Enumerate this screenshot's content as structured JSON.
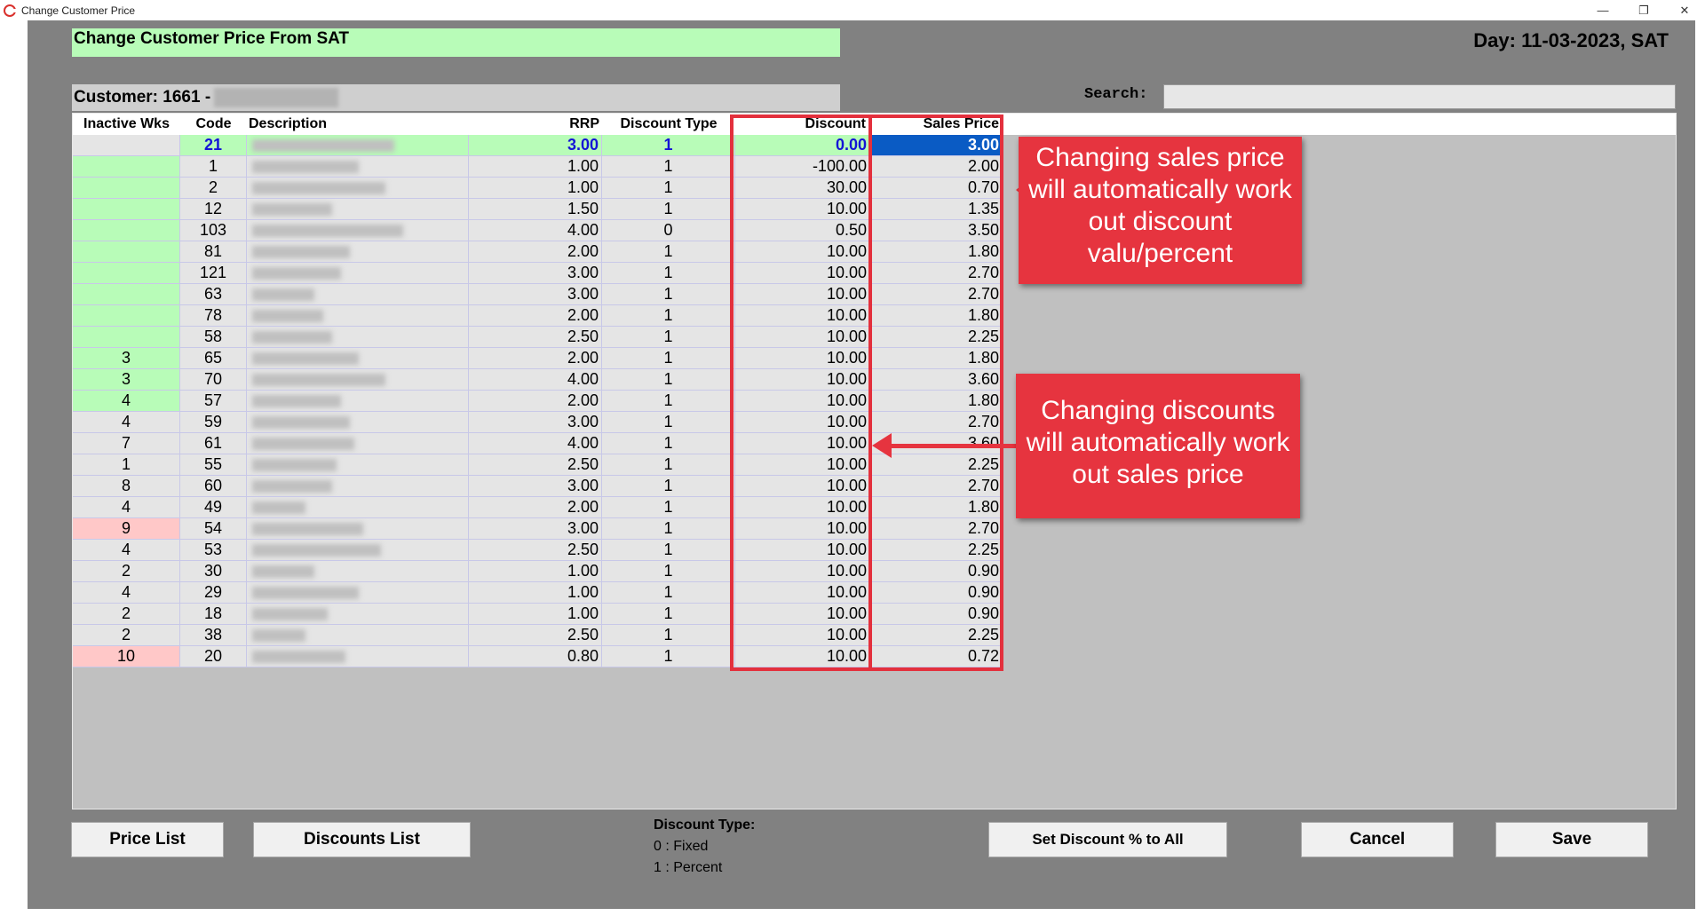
{
  "window": {
    "title": "Change Customer Price",
    "controls": [
      "minimize-icon",
      "restore-icon",
      "close-icon"
    ]
  },
  "header": {
    "title": "Change Customer Price From SAT",
    "day": "Day: 11-03-2023, SAT"
  },
  "customer": {
    "label": "Customer: 1661 -"
  },
  "search": {
    "label": "Search:",
    "value": ""
  },
  "table": {
    "columns": {
      "inactive": "Inactive Wks",
      "code": "Code",
      "description": "Description",
      "rrp": "RRP",
      "discount_type": "Discount Type",
      "discount": "Discount",
      "sales_price": "Sales Price"
    },
    "rows": [
      {
        "inactive": "",
        "code": "21",
        "rrp": "3.00",
        "dtype": "1",
        "discount": "0.00",
        "sales": "3.00",
        "inactive_bg": "none"
      },
      {
        "inactive": "",
        "code": "1",
        "rrp": "1.00",
        "dtype": "1",
        "discount": "-100.00",
        "sales": "2.00",
        "inactive_bg": "green"
      },
      {
        "inactive": "",
        "code": "2",
        "rrp": "1.00",
        "dtype": "1",
        "discount": "30.00",
        "sales": "0.70",
        "inactive_bg": "green"
      },
      {
        "inactive": "",
        "code": "12",
        "rrp": "1.50",
        "dtype": "1",
        "discount": "10.00",
        "sales": "1.35",
        "inactive_bg": "green"
      },
      {
        "inactive": "",
        "code": "103",
        "rrp": "4.00",
        "dtype": "0",
        "discount": "0.50",
        "sales": "3.50",
        "inactive_bg": "green"
      },
      {
        "inactive": "",
        "code": "81",
        "rrp": "2.00",
        "dtype": "1",
        "discount": "10.00",
        "sales": "1.80",
        "inactive_bg": "green"
      },
      {
        "inactive": "",
        "code": "121",
        "rrp": "3.00",
        "dtype": "1",
        "discount": "10.00",
        "sales": "2.70",
        "inactive_bg": "green"
      },
      {
        "inactive": "",
        "code": "63",
        "rrp": "3.00",
        "dtype": "1",
        "discount": "10.00",
        "sales": "2.70",
        "inactive_bg": "green"
      },
      {
        "inactive": "",
        "code": "78",
        "rrp": "2.00",
        "dtype": "1",
        "discount": "10.00",
        "sales": "1.80",
        "inactive_bg": "green"
      },
      {
        "inactive": "",
        "code": "58",
        "rrp": "2.50",
        "dtype": "1",
        "discount": "10.00",
        "sales": "2.25",
        "inactive_bg": "green"
      },
      {
        "inactive": "3",
        "code": "65",
        "rrp": "2.00",
        "dtype": "1",
        "discount": "10.00",
        "sales": "1.80",
        "inactive_bg": "green"
      },
      {
        "inactive": "3",
        "code": "70",
        "rrp": "4.00",
        "dtype": "1",
        "discount": "10.00",
        "sales": "3.60",
        "inactive_bg": "green"
      },
      {
        "inactive": "4",
        "code": "57",
        "rrp": "2.00",
        "dtype": "1",
        "discount": "10.00",
        "sales": "1.80",
        "inactive_bg": "green"
      },
      {
        "inactive": "4",
        "code": "59",
        "rrp": "3.00",
        "dtype": "1",
        "discount": "10.00",
        "sales": "2.70",
        "inactive_bg": "none"
      },
      {
        "inactive": "7",
        "code": "61",
        "rrp": "4.00",
        "dtype": "1",
        "discount": "10.00",
        "sales": "3.60",
        "inactive_bg": "none"
      },
      {
        "inactive": "1",
        "code": "55",
        "rrp": "2.50",
        "dtype": "1",
        "discount": "10.00",
        "sales": "2.25",
        "inactive_bg": "none"
      },
      {
        "inactive": "8",
        "code": "60",
        "rrp": "3.00",
        "dtype": "1",
        "discount": "10.00",
        "sales": "2.70",
        "inactive_bg": "none"
      },
      {
        "inactive": "4",
        "code": "49",
        "rrp": "2.00",
        "dtype": "1",
        "discount": "10.00",
        "sales": "1.80",
        "inactive_bg": "none"
      },
      {
        "inactive": "9",
        "code": "54",
        "rrp": "3.00",
        "dtype": "1",
        "discount": "10.00",
        "sales": "2.70",
        "inactive_bg": "pink"
      },
      {
        "inactive": "4",
        "code": "53",
        "rrp": "2.50",
        "dtype": "1",
        "discount": "10.00",
        "sales": "2.25",
        "inactive_bg": "none"
      },
      {
        "inactive": "2",
        "code": "30",
        "rrp": "1.00",
        "dtype": "1",
        "discount": "10.00",
        "sales": "0.90",
        "inactive_bg": "none"
      },
      {
        "inactive": "4",
        "code": "29",
        "rrp": "1.00",
        "dtype": "1",
        "discount": "10.00",
        "sales": "0.90",
        "inactive_bg": "none"
      },
      {
        "inactive": "2",
        "code": "18",
        "rrp": "1.00",
        "dtype": "1",
        "discount": "10.00",
        "sales": "0.90",
        "inactive_bg": "none"
      },
      {
        "inactive": "2",
        "code": "38",
        "rrp": "2.50",
        "dtype": "1",
        "discount": "10.00",
        "sales": "2.25",
        "inactive_bg": "none"
      },
      {
        "inactive": "10",
        "code": "20",
        "rrp": "0.80",
        "dtype": "1",
        "discount": "10.00",
        "sales": "0.72",
        "inactive_bg": "pink"
      }
    ]
  },
  "annotations": {
    "sales_callout": "Changing sales price will automatically work out discount valu/percent",
    "discount_callout": "Changing discounts will automatically work out sales price"
  },
  "footer": {
    "price_list": "Price List",
    "discounts_list": "Discounts List",
    "dtype_title": "Discount Type:",
    "dtype_fixed": "0 : Fixed",
    "dtype_percent": "1 : Percent",
    "set_discount_all": "Set Discount % to All",
    "cancel": "Cancel",
    "save": "Save"
  },
  "colors": {
    "panel": "#818181",
    "green_row": "#b8fcb8",
    "pink_row": "#ffc8c8",
    "selected": "#0a5bc4",
    "callout": "#e6343f"
  }
}
